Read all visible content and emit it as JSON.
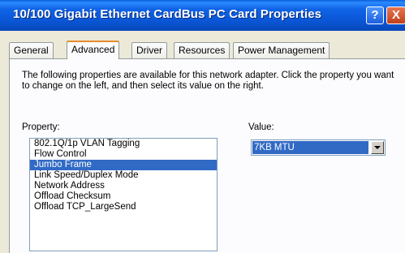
{
  "window": {
    "title": "10/100 Gigabit Ethernet CardBus PC Card Properties",
    "help_label": "?",
    "close_label": "X"
  },
  "tabs": [
    {
      "label": "General"
    },
    {
      "label": "Advanced"
    },
    {
      "label": "Driver"
    },
    {
      "label": "Resources"
    },
    {
      "label": "Power Management"
    }
  ],
  "active_tab": "Advanced",
  "description": "The following properties are available for this network adapter. Click the property you want to change on the left, and then select its value on the right.",
  "property_label": "Property:",
  "value_label": "Value:",
  "properties": [
    {
      "label": "802.1Q/1p VLAN Tagging"
    },
    {
      "label": "Flow Control"
    },
    {
      "label": "Jumbo Frame"
    },
    {
      "label": "Link Speed/Duplex Mode"
    },
    {
      "label": "Network Address"
    },
    {
      "label": "Offload Checksum"
    },
    {
      "label": "Offload TCP_LargeSend"
    }
  ],
  "selected_property": "Jumbo Frame",
  "value_selected": "7KB MTU",
  "colors": {
    "title_bar": "#0a55d4",
    "selection": "#316ac5",
    "active_tab_accent": "#e68b2c"
  }
}
